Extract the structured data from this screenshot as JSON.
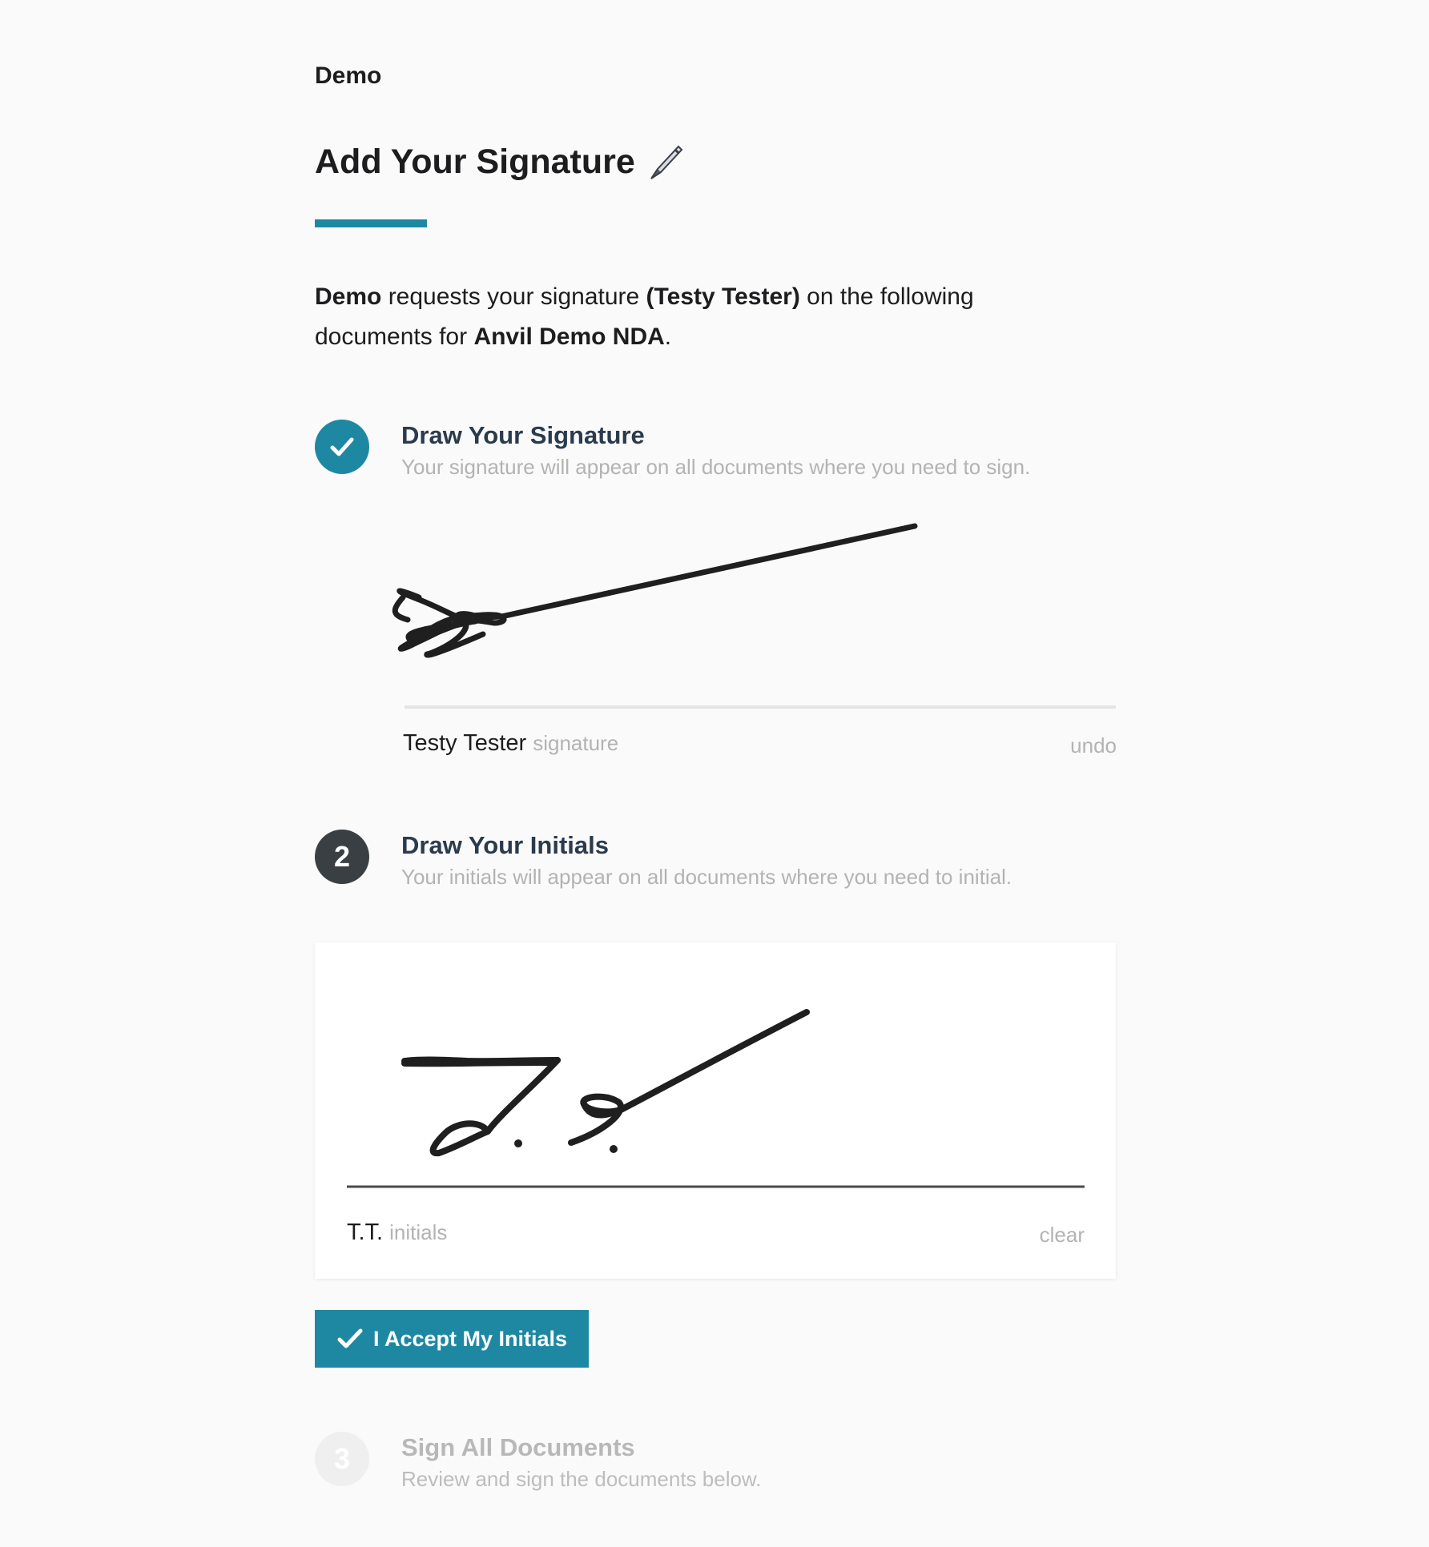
{
  "header": {
    "org_name": "Demo",
    "title": "Add Your Signature",
    "title_icon": "pen-icon",
    "accent_color": "#1e88a2"
  },
  "intro": {
    "requester": "Demo",
    "text_1": " requests your signature ",
    "signer": "(Testy Tester)",
    "text_2": " on the following documents for ",
    "packet_name": "Anvil Demo NDA",
    "text_3": "."
  },
  "steps": [
    {
      "status": "complete",
      "marker": "check-icon",
      "title": "Draw Your Signature",
      "description": "Your signature will appear on all documents where you need to sign.",
      "name": "Testy Tester",
      "role": "signature",
      "action": "undo"
    },
    {
      "status": "active",
      "number": "2",
      "title": "Draw Your Initials",
      "description": "Your initials will appear on all documents where you need to initial.",
      "name": "T.T.",
      "role": "initials",
      "action": "clear",
      "button_label": "I Accept My Initials"
    },
    {
      "status": "pending",
      "number": "3",
      "title": "Sign All Documents",
      "description": "Review and sign the documents below."
    }
  ]
}
